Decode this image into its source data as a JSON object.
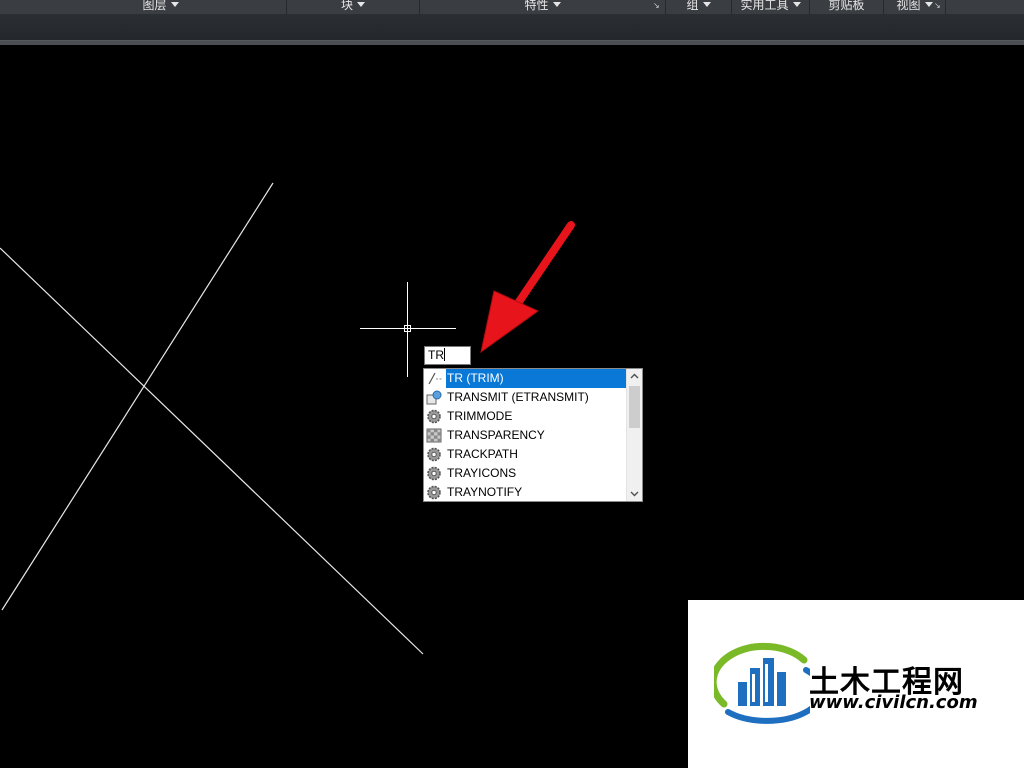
{
  "ribbon": {
    "panels": [
      {
        "label": "图层",
        "dropdown": true
      },
      {
        "label": "块",
        "dropdown": true
      },
      {
        "label": "特性",
        "dropdown": true
      },
      {
        "label": "组",
        "dropdown": true
      },
      {
        "label": "实用工具",
        "dropdown": true
      },
      {
        "label": "剪贴板",
        "dropdown": false
      },
      {
        "label": "视图",
        "dropdown": true
      }
    ]
  },
  "command": {
    "input_value": "TR"
  },
  "autocomplete": {
    "items": [
      {
        "label": "TR (TRIM)",
        "icon": "trim-icon",
        "selected": true
      },
      {
        "label": "TRANSMIT (ETRANSMIT)",
        "icon": "etransmit-icon",
        "selected": false
      },
      {
        "label": "TRIMMODE",
        "icon": "gear-icon",
        "selected": false
      },
      {
        "label": "TRANSPARENCY",
        "icon": "transparency-icon",
        "selected": false
      },
      {
        "label": "TRACKPATH",
        "icon": "gear-icon",
        "selected": false
      },
      {
        "label": "TRAYICONS",
        "icon": "gear-icon",
        "selected": false
      },
      {
        "label": "TRAYNOTIFY",
        "icon": "gear-icon",
        "selected": false
      }
    ]
  },
  "watermark": {
    "name": "土木工程网",
    "url": "www.civilcn.com"
  },
  "colors": {
    "canvas_background": "#000000",
    "selection": "#0a78d7",
    "annotation_arrow": "#e8141b",
    "logo_green": "#7ab928",
    "logo_blue": "#1e6fc0"
  }
}
